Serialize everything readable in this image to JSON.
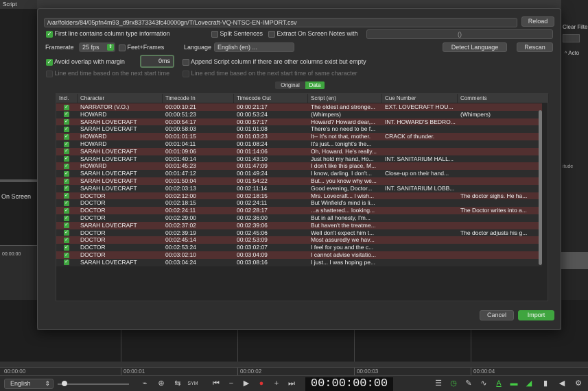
{
  "bg": {
    "script_label": "Script",
    "on_screen_label": "On Screen",
    "time_left": "00:00:00",
    "clear_filter": "Clear Filte",
    "actor_col": "Acto",
    "altitude": "itude"
  },
  "timeline": {
    "ticks": [
      "00:00:00",
      "00:00:01",
      "00:00:02",
      "00:00:03",
      "00:00:04"
    ]
  },
  "toolbar": {
    "language": "English",
    "timecode": "00:00:00:00"
  },
  "dialog": {
    "path": "/var/folders/84/05pfn4m93_d9rx8373343fc40000gn/T/Lovecraft-VQ-NTSC-EN-IMPORT.csv",
    "reload": "Reload",
    "first_line": "First line contains column type information",
    "split_sentences": "Split Sentences",
    "extract_notes": "Extract On Screen Notes with",
    "extract_value": "()",
    "framerate_label": "Framerate",
    "framerate_value": "25 fps",
    "feet_frames": "Feet+Frames",
    "language_label": "Language",
    "language_value": "English (en) ...",
    "detect_language": "Detect Language",
    "rescan": "Rescan",
    "avoid_overlap": "Avoid overlap with margin",
    "margin_value": "0ms",
    "append_script": "Append Script column if there are other columns exist but empty",
    "line_end_next": "Line end time based on the next start time",
    "line_end_same": "Line end time based on the next start time of same character",
    "tab_original": "Original",
    "tab_data": "Data",
    "cancel": "Cancel",
    "import": "Import"
  },
  "table": {
    "headers": [
      "Incl.",
      "Character",
      "Timecode In",
      "Timecode Out",
      "Script (en)",
      "Cue Number",
      "Comments"
    ],
    "rows": [
      [
        "NARRATOR (V.O.)",
        "00:00:10:21",
        "00:00:21:17",
        "The oldest and stronge...",
        "EXT. LOVECRAFT HOU...",
        ""
      ],
      [
        "HOWARD",
        "00:00:51:23",
        "00:00:53:24",
        "(Whimpers)",
        "",
        "(Whimpers)"
      ],
      [
        "SARAH LOVECRAFT",
        "00:00:54:17",
        "00:00:57:17",
        "Howard? Howard dear,...",
        "INT. HOWARD'S BEDRO...",
        ""
      ],
      [
        "SARAH LOVECRAFT",
        "00:00:58:03",
        "00:01:01:08",
        "There's no need to be f...",
        "",
        ""
      ],
      [
        "HOWARD",
        "00:01:01:15",
        "00:01:03:23",
        "It-- It's not that, mother.",
        "CRACK of thunder.",
        ""
      ],
      [
        "HOWARD",
        "00:01:04:11",
        "00:01:08:24",
        "It's just... tonight's the...",
        "",
        ""
      ],
      [
        "SARAH LOVECRAFT",
        "00:01:09:06",
        "00:01:14:06",
        "Oh, Howard. He's really...",
        "",
        ""
      ],
      [
        "SARAH LOVECRAFT",
        "00:01:40:14",
        "00:01:43:10",
        "Just hold my hand, Ho...",
        "INT. SANITARIUM HALL...",
        ""
      ],
      [
        "HOWARD",
        "00:01:45:23",
        "00:01:47:09",
        "I don't like this place, M...",
        "",
        ""
      ],
      [
        "SARAH LOVECRAFT",
        "00:01:47:12",
        "00:01:49:24",
        "I know, darling. I don't...",
        "Close-up on their hand...",
        ""
      ],
      [
        "SARAH LOVECRAFT",
        "00:01:50:04",
        "00:01:54:22",
        "But... you know why we...",
        "",
        ""
      ],
      [
        "SARAH LOVECRAFT",
        "00:02:03:13",
        "00:02:11:14",
        "Good evening, Doctor...",
        "INT. SANITARIUM LOBB...",
        ""
      ],
      [
        "DOCTOR",
        "00:02:12:00",
        "00:02:18:15",
        "Mrs. Lovecraft... I wish...",
        "",
        "The doctor sighs. He ha..."
      ],
      [
        "DOCTOR",
        "00:02:18:15",
        "00:02:24:11",
        "But Winfield's mind is li...",
        "",
        ""
      ],
      [
        "DOCTOR",
        "00:02:24:11",
        "00:02:28:17",
        "...a shattered... looking...",
        "",
        "The Doctor writes into a..."
      ],
      [
        "DOCTOR",
        "00:02:29:00",
        "00:02:36:00",
        "But in all honesty, I'm...",
        "",
        ""
      ],
      [
        "SARAH LOVECRAFT",
        "00:02:37:02",
        "00:02:39:06",
        "But haven't the treatme...",
        "",
        ""
      ],
      [
        "DOCTOR",
        "00:02:39:19",
        "00:02:45:06",
        "Well don't expect him t...",
        "",
        "The doctor adjusts his g..."
      ],
      [
        "DOCTOR",
        "00:02:45:14",
        "00:02:53:09",
        "Most assuredly we hav...",
        "",
        ""
      ],
      [
        "DOCTOR",
        "00:02:53:24",
        "00:03:02:07",
        "I feel for you and the c...",
        "",
        ""
      ],
      [
        "DOCTOR",
        "00:03:02:10",
        "00:03:04:09",
        "I cannot advise visitatio...",
        "",
        ""
      ],
      [
        "SARAH LOVECRAFT",
        "00:03:04:24",
        "00:03:08:16",
        "I just... I was hoping pe...",
        "",
        ""
      ]
    ]
  }
}
